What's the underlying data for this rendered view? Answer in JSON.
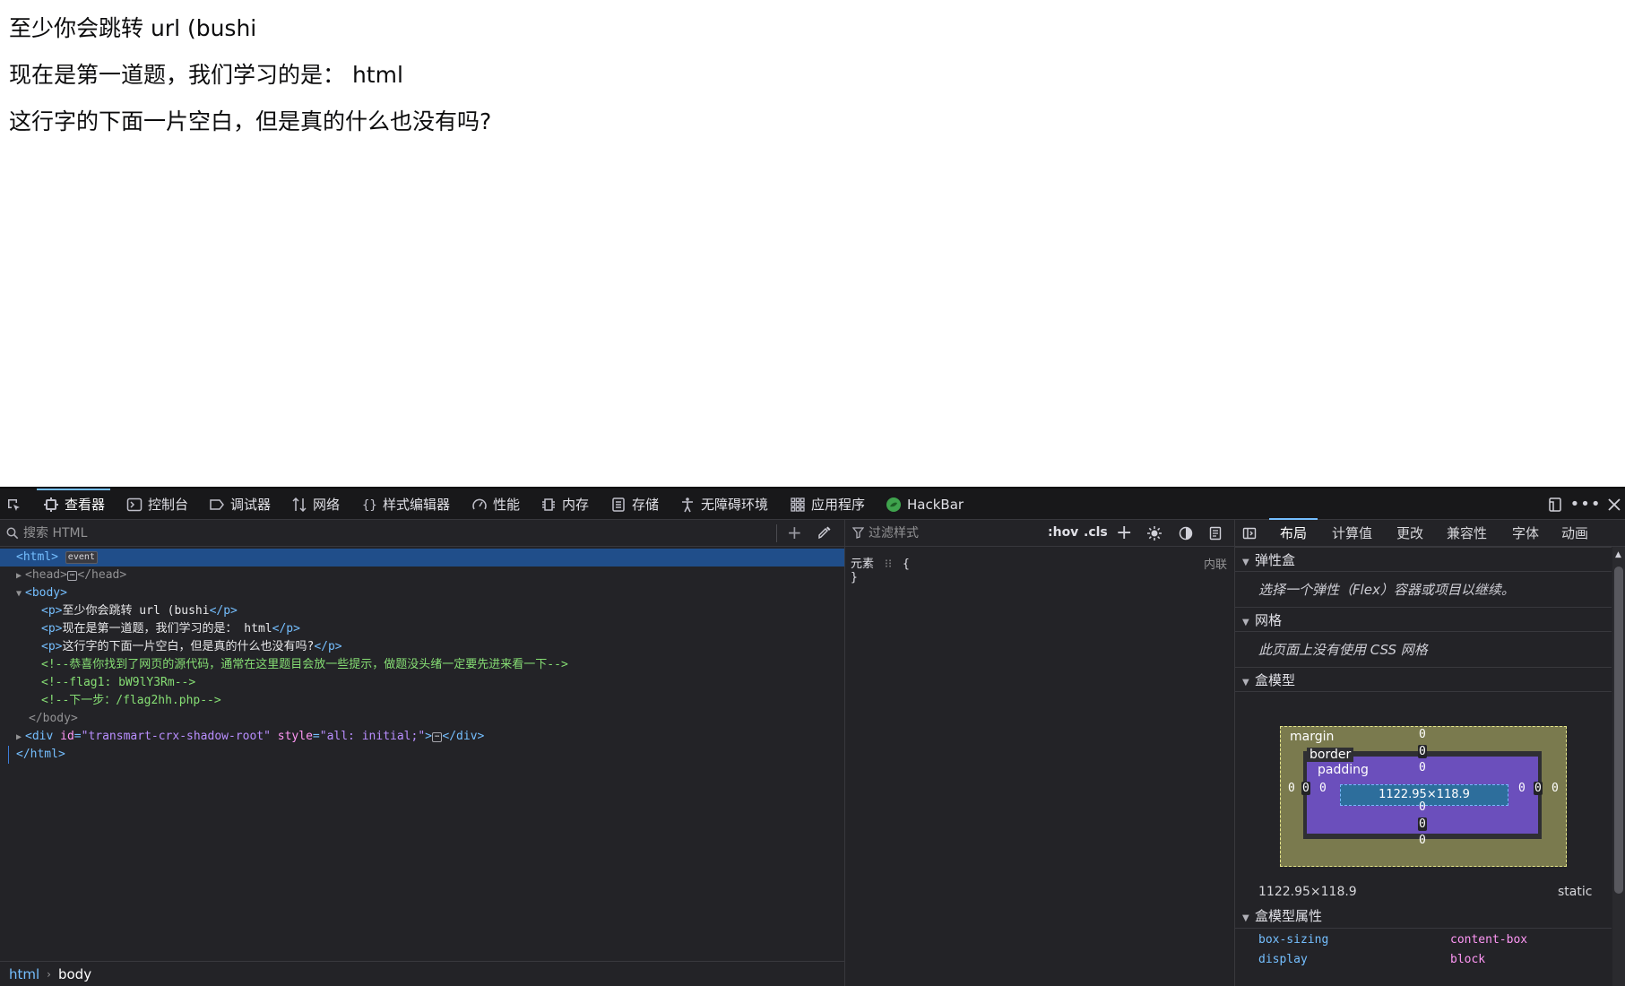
{
  "page": {
    "line1": "至少你会跳转 url (bushi",
    "line2": "现在是第一道题，我们学习的是： html",
    "line3": "这行字的下面一片空白，但是真的什么也没有吗?"
  },
  "devtools": {
    "tabs": [
      {
        "label": "查看器",
        "icon": "inspector-icon"
      },
      {
        "label": "控制台",
        "icon": "console-icon"
      },
      {
        "label": "调试器",
        "icon": "debugger-icon"
      },
      {
        "label": "网络",
        "icon": "network-icon"
      },
      {
        "label": "样式编辑器",
        "icon": "style-editor-icon"
      },
      {
        "label": "性能",
        "icon": "performance-icon"
      },
      {
        "label": "内存",
        "icon": "memory-icon"
      },
      {
        "label": "存储",
        "icon": "storage-icon"
      },
      {
        "label": "无障碍环境",
        "icon": "accessibility-icon"
      },
      {
        "label": "应用程序",
        "icon": "application-icon"
      },
      {
        "label": "HackBar",
        "icon": "hackbar-icon"
      }
    ],
    "search_placeholder": "搜索 HTML",
    "markup": {
      "html_open": "<html>",
      "event_badge": "event",
      "head_open": "<head>",
      "head_close": "</head>",
      "body_open": "<body>",
      "p1": {
        "open": "<p>",
        "text": "至少你会跳转 url (bushi",
        "close": "</p>"
      },
      "p2": {
        "open": "<p>",
        "text": "现在是第一道题，我们学习的是： html",
        "close": "</p>"
      },
      "p3": {
        "open": "<p>",
        "text": "这行字的下面一片空白，但是真的什么也没有吗?",
        "close": "</p>"
      },
      "comment1": "<!--恭喜你找到了网页的源代码，通常在这里题目会放一些提示，做题没头绪一定要先进来看一下-->",
      "comment2": "<!--flag1: bW9lY3Rm-->",
      "comment3": "<!--下一步：/flag2hh.php-->",
      "body_close": "</body>",
      "div_tag": "<div",
      "div_id_attr": "id",
      "div_id_val": "\"transmart-crx-shadow-root\"",
      "div_style_attr": "style",
      "div_style_val": "\"all: initial;\"",
      "div_gt": ">",
      "div_close": "</div>",
      "html_close": "</html>"
    },
    "breadcrumbs": [
      "html",
      "body"
    ],
    "rules": {
      "filter_placeholder": "过滤样式",
      "hov": ":hov",
      "cls": ".cls",
      "element_selector": "元素",
      "open_brace": "{",
      "close_brace": "}",
      "inline_label": "内联"
    },
    "layout": {
      "tabs": [
        "布局",
        "计算值",
        "更改",
        "兼容性",
        "字体",
        "动画"
      ],
      "flexbox_title": "弹性盒",
      "flexbox_note": "选择一个弹性（Flex）容器或项目以继续。",
      "grid_title": "网格",
      "grid_note": "此页面上没有使用 CSS 网格",
      "boxmodel_title": "盒模型",
      "margin_label": "margin",
      "border_label": "border",
      "padding_label": "padding",
      "content_size": "1122.95×118.9",
      "zero": "0",
      "dimensions": "1122.95×118.9",
      "position": "static",
      "props_title": "盒模型属性",
      "props": [
        {
          "name": "box-sizing",
          "value": "content-box"
        },
        {
          "name": "display",
          "value": "block"
        }
      ]
    }
  }
}
